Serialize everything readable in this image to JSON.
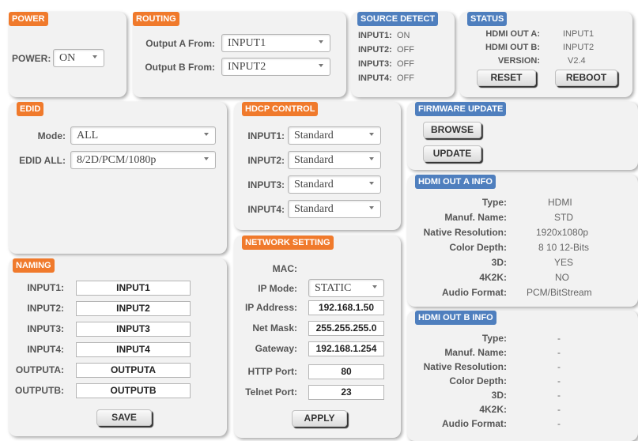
{
  "power": {
    "title": "POWER",
    "label": "POWER:",
    "value": "ON"
  },
  "routing": {
    "title": "ROUTING",
    "rows": [
      {
        "label": "Output A From:",
        "value": "INPUT1"
      },
      {
        "label": "Output B From:",
        "value": "INPUT2"
      }
    ]
  },
  "source_detect": {
    "title": "SOURCE DETECT",
    "rows": [
      {
        "label": "INPUT1:",
        "value": "ON"
      },
      {
        "label": "INPUT2:",
        "value": "OFF"
      },
      {
        "label": "INPUT3:",
        "value": "OFF"
      },
      {
        "label": "INPUT4:",
        "value": "OFF"
      }
    ]
  },
  "status": {
    "title": "STATUS",
    "rows": [
      {
        "label": "HDMI OUT A:",
        "value": "INPUT1"
      },
      {
        "label": "HDMI OUT B:",
        "value": "INPUT2"
      },
      {
        "label": "VERSION:",
        "value": "V2.4"
      }
    ],
    "reset_label": "RESET",
    "reboot_label": "REBOOT"
  },
  "edid": {
    "title": "EDID",
    "mode_label": "Mode:",
    "mode_value": "ALL",
    "all_label": "EDID ALL:",
    "all_value": "8/2D/PCM/1080p"
  },
  "hdcp": {
    "title": "HDCP CONTROL",
    "rows": [
      {
        "label": "INPUT1:",
        "value": "Standard"
      },
      {
        "label": "INPUT2:",
        "value": "Standard"
      },
      {
        "label": "INPUT3:",
        "value": "Standard"
      },
      {
        "label": "INPUT4:",
        "value": "Standard"
      }
    ]
  },
  "firmware": {
    "title": "FIRMWARE UPDATE",
    "browse_label": "BROWSE",
    "update_label": "UPDATE"
  },
  "hdmi_a": {
    "title": "HDMI OUT A INFO",
    "rows": [
      {
        "label": "Type:",
        "value": "HDMI"
      },
      {
        "label": "Manuf. Name:",
        "value": "STD"
      },
      {
        "label": "Native Resolution:",
        "value": "1920x1080p"
      },
      {
        "label": "Color Depth:",
        "value": "8 10 12-Bits"
      },
      {
        "label": "3D:",
        "value": "YES"
      },
      {
        "label": "4K2K:",
        "value": "NO"
      },
      {
        "label": "Audio Format:",
        "value": "PCM/BitStream"
      }
    ]
  },
  "hdmi_b": {
    "title": "HDMI OUT B INFO",
    "rows": [
      {
        "label": "Type:",
        "value": "-"
      },
      {
        "label": "Manuf. Name:",
        "value": "-"
      },
      {
        "label": "Native Resolution:",
        "value": "-"
      },
      {
        "label": "Color Depth:",
        "value": "-"
      },
      {
        "label": "3D:",
        "value": "-"
      },
      {
        "label": "4K2K:",
        "value": "-"
      },
      {
        "label": "Audio Format:",
        "value": "-"
      }
    ]
  },
  "naming": {
    "title": "NAMING",
    "rows": [
      {
        "label": "INPUT1:",
        "value": "INPUT1"
      },
      {
        "label": "INPUT2:",
        "value": "INPUT2"
      },
      {
        "label": "INPUT3:",
        "value": "INPUT3"
      },
      {
        "label": "INPUT4:",
        "value": "INPUT4"
      },
      {
        "label": "OUTPUTA:",
        "value": "OUTPUTA"
      },
      {
        "label": "OUTPUTB:",
        "value": "OUTPUTB"
      }
    ],
    "save_label": "SAVE"
  },
  "network": {
    "title": "NETWORK SETTING",
    "mac_label": "MAC:",
    "mac_value": "",
    "ipmode_label": "IP Mode:",
    "ipmode_value": "STATIC",
    "rows": [
      {
        "label": "IP Address:",
        "value": "192.168.1.50"
      },
      {
        "label": "Net Mask:",
        "value": "255.255.255.0"
      },
      {
        "label": "Gateway:",
        "value": "192.168.1.254"
      },
      {
        "label": "HTTP Port:",
        "value": "80"
      },
      {
        "label": "Telnet Port:",
        "value": "23"
      }
    ],
    "apply_label": "APPLY"
  },
  "colors": {
    "orange_title": "#f07a2c",
    "blue_title": "#4f7fbe",
    "panel_bg": "#f2f2f2"
  }
}
